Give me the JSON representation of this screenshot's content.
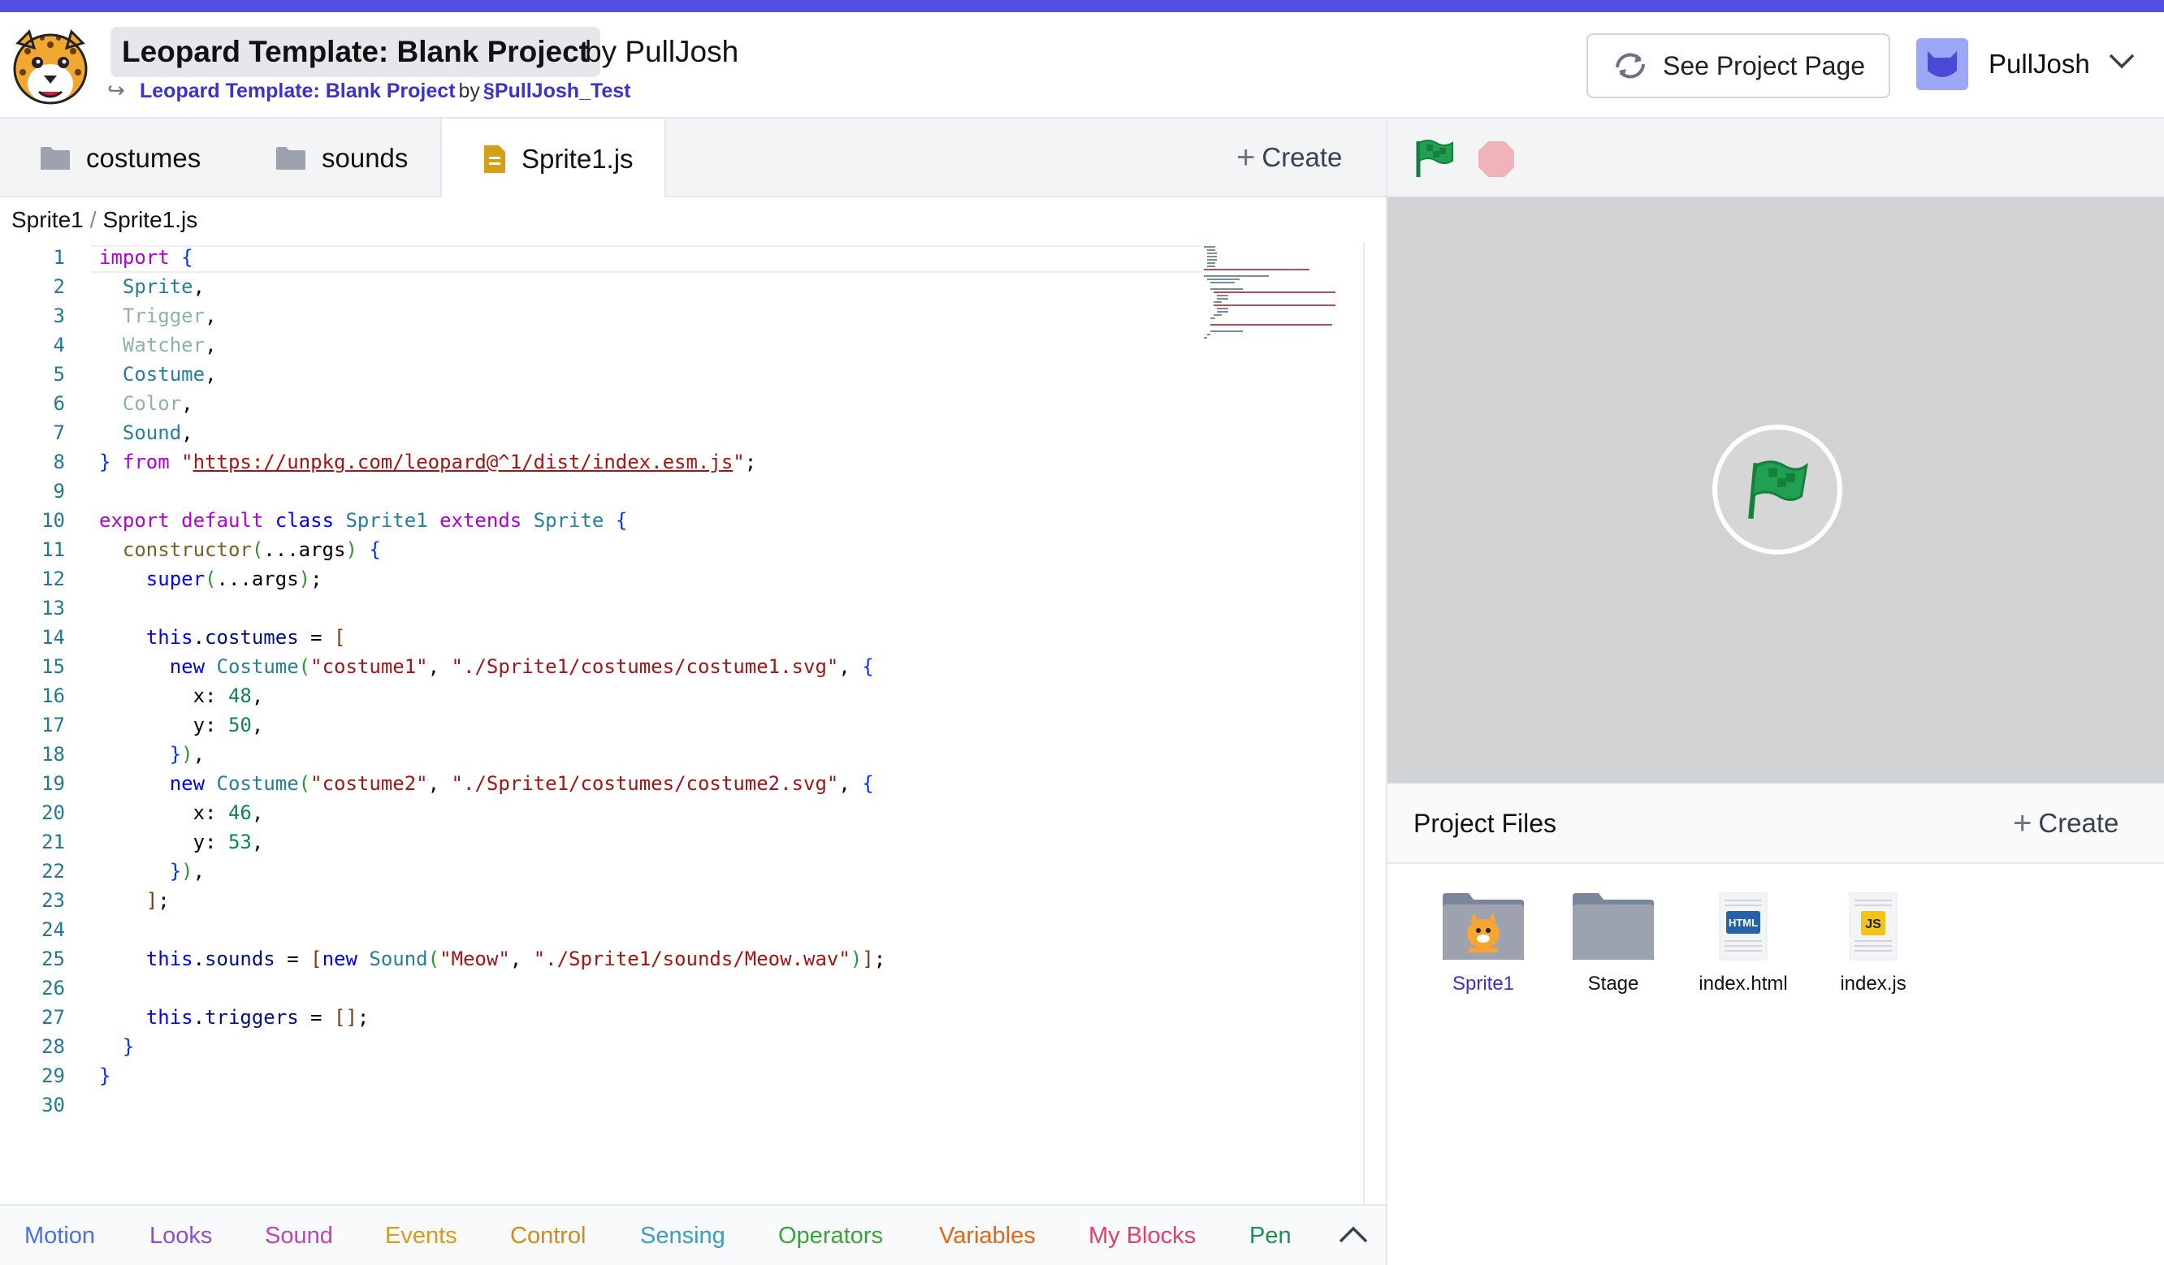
{
  "header": {
    "project_title": "Leopard Template: Blank Project",
    "by_author": "by PullJosh",
    "remix_of_title": "Leopard Template: Blank Project",
    "remix_by": "by",
    "remix_author": "PullJosh_Test",
    "see_project_label": "See Project Page",
    "username": "PullJosh"
  },
  "tabs": [
    {
      "label": "costumes",
      "icon": "folder-icon"
    },
    {
      "label": "sounds",
      "icon": "folder-icon"
    },
    {
      "label": "Sprite1.js",
      "icon": "file-icon",
      "active": true
    }
  ],
  "create_label": "Create",
  "breadcrumb": [
    "Sprite1",
    "Sprite1.js"
  ],
  "editor": {
    "line_numbers": [
      "1",
      "2",
      "3",
      "4",
      "5",
      "6",
      "7",
      "8",
      "9",
      "10",
      "11",
      "12",
      "13",
      "14",
      "15",
      "16",
      "17",
      "18",
      "19",
      "20",
      "21",
      "22",
      "23",
      "24",
      "25",
      "26",
      "27",
      "28",
      "29",
      "30"
    ],
    "code_lines": [
      "import {",
      "  Sprite,",
      "  Trigger,",
      "  Watcher,",
      "  Costume,",
      "  Color,",
      "  Sound,",
      "} from \"https://unpkg.com/leopard@^1/dist/index.esm.js\";",
      "",
      "export default class Sprite1 extends Sprite {",
      "  constructor(...args) {",
      "    super(...args);",
      "",
      "    this.costumes = [",
      "      new Costume(\"costume1\", \"./Sprite1/costumes/costume1.svg\", {",
      "        x: 48,",
      "        y: 50,",
      "      }),",
      "      new Costume(\"costume2\", \"./Sprite1/costumes/costume2.svg\", {",
      "        x: 46,",
      "        y: 53,",
      "      }),",
      "    ];",
      "",
      "    this.sounds = [new Sound(\"Meow\", \"./Sprite1/sounds/Meow.wav\")];",
      "",
      "    this.triggers = [];",
      "  }",
      "}",
      ""
    ]
  },
  "categories": [
    {
      "label": "Motion",
      "color": "#4c6ee6"
    },
    {
      "label": "Looks",
      "color": "#8b4fd6"
    },
    {
      "label": "Sound",
      "color": "#c040c0"
    },
    {
      "label": "Events",
      "color": "#d99a1e"
    },
    {
      "label": "Control",
      "color": "#d08a1a"
    },
    {
      "label": "Sensing",
      "color": "#3a9dc4"
    },
    {
      "label": "Operators",
      "color": "#3aa23a"
    },
    {
      "label": "Variables",
      "color": "#e0661a"
    },
    {
      "label": "My Blocks",
      "color": "#e0406a"
    },
    {
      "label": "Pen",
      "color": "#1f8f4f"
    }
  ],
  "project_files": {
    "title": "Project Files",
    "create_label": "Create",
    "items": [
      {
        "label": "Sprite1",
        "icon": "sprite-folder-icon",
        "selected": true
      },
      {
        "label": "Stage",
        "icon": "folder-icon"
      },
      {
        "label": "index.html",
        "icon": "html-file-icon",
        "badge": "HTML"
      },
      {
        "label": "index.js",
        "icon": "js-file-icon",
        "badge": "JS"
      }
    ]
  },
  "colors": {
    "accent": "#5450e6",
    "link": "#3b33c9",
    "flag_green": "#1f9d55",
    "stop_red": "#f0b4b8",
    "stage_bg": "#d1d2d3"
  }
}
